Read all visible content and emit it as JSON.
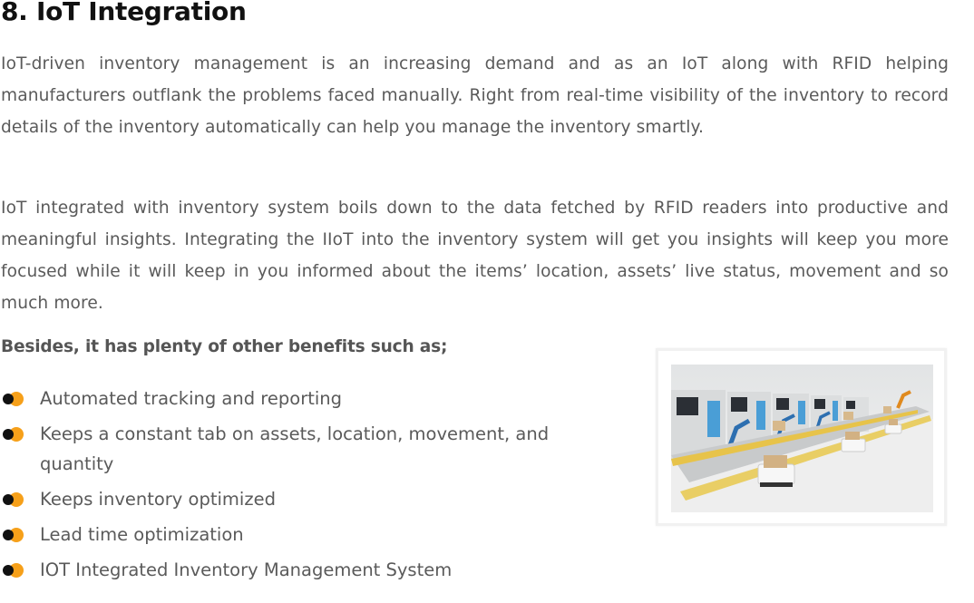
{
  "article": {
    "heading": "8. IoT Integration",
    "paragraphs": [
      "IoT-driven inventory management is an increasing demand and as an IoT along with RFID helping manufacturers outflank the problems faced manually. Right from real-time visibility of the inventory to record details of the inventory automatically can help you manage the inventory smartly.",
      "IoT integrated with inventory system boils down to the data fetched by RFID readers into productive and meaningful insights. Integrating the IIoT into the inventory system will get you insights will keep you more focused while it will keep in you informed about the items’ location, assets’ live status, movement and so much more."
    ],
    "benefits_title": "Besides, it has plenty of other benefits such as;",
    "benefits": [
      "Automated tracking and reporting",
      "Keeps a constant tab on assets, location, movement, and quantity",
      "Keeps inventory optimized",
      "Lead time optimization",
      "IOT Integrated Inventory Management System"
    ],
    "image": {
      "icon": "factory-automation-photo"
    }
  },
  "colors": {
    "bullet_accent": "#f6a01a",
    "bullet_dark": "#111111",
    "body_text": "#5a5a5a",
    "heading_text": "#111111"
  }
}
